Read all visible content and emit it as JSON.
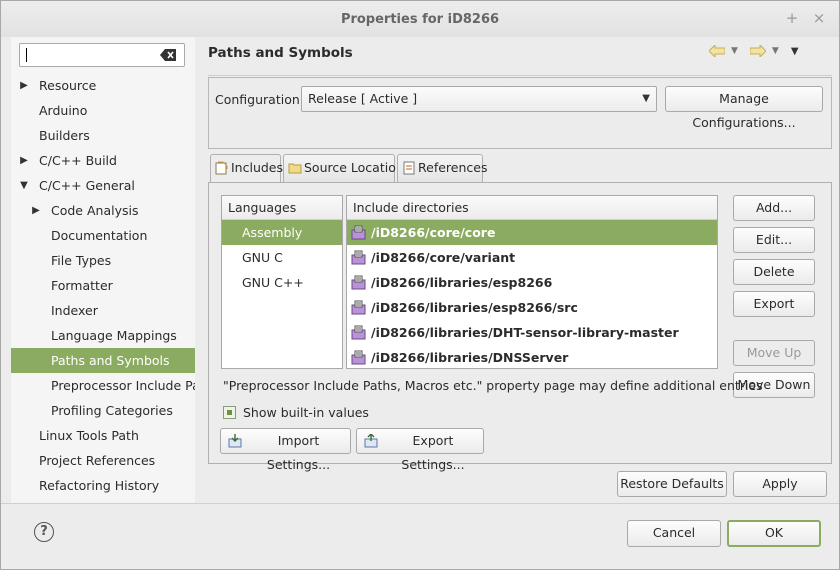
{
  "window": {
    "title": "Properties for iD8266",
    "min_glyph": "+",
    "close_glyph": "×"
  },
  "filter": {
    "value": "",
    "clear_icon": "clear-icon"
  },
  "sidebar": {
    "items": [
      {
        "label": "Resource",
        "expander": "▶"
      },
      {
        "label": "Arduino",
        "expander": ""
      },
      {
        "label": "Builders",
        "expander": ""
      },
      {
        "label": "C/C++ Build",
        "expander": "▶"
      },
      {
        "label": "C/C++ General",
        "expander": "▼"
      },
      {
        "label": "Code Analysis",
        "expander": "▶"
      },
      {
        "label": "Documentation",
        "expander": ""
      },
      {
        "label": "File Types",
        "expander": ""
      },
      {
        "label": "Formatter",
        "expander": ""
      },
      {
        "label": "Indexer",
        "expander": ""
      },
      {
        "label": "Language Mappings",
        "expander": ""
      },
      {
        "label": "Paths and Symbols",
        "expander": ""
      },
      {
        "label": "Preprocessor Include Paths, Macros etc.",
        "expander": ""
      },
      {
        "label": "Profiling Categories",
        "expander": ""
      },
      {
        "label": "Linux Tools Path",
        "expander": ""
      },
      {
        "label": "Project References",
        "expander": ""
      },
      {
        "label": "Refactoring History",
        "expander": ""
      }
    ],
    "selected": "Paths and Symbols"
  },
  "page": {
    "title": "Paths and Symbols",
    "nav": {
      "back_icon": "back-arrow-icon",
      "forward_icon": "forward-arrow-icon",
      "dropdown_glyph": "▼"
    }
  },
  "configuration": {
    "label": "Configuration:",
    "value": "Release  [ Active ]",
    "dropdown_glyph": "▼",
    "manage_button": "Manage Configurations..."
  },
  "tabs": [
    {
      "label": "Includes",
      "active": true
    },
    {
      "label": "Source Location",
      "active": false
    },
    {
      "label": "References",
      "active": false
    }
  ],
  "languages": {
    "header": "Languages",
    "items": [
      "Assembly",
      "GNU C",
      "GNU C++"
    ],
    "selected": "Assembly"
  },
  "includes": {
    "header": "Include directories",
    "items": [
      "/iD8266/core/core",
      "/iD8266/core/variant",
      "/iD8266/libraries/esp8266",
      "/iD8266/libraries/esp8266/src",
      "/iD8266/libraries/DHT-sensor-library-master",
      "/iD8266/libraries/DNSServer"
    ],
    "selected": "/iD8266/core/core"
  },
  "side_buttons": {
    "add": "Add...",
    "edit": "Edit...",
    "delete": "Delete",
    "export": "Export",
    "move_up": "Move Up",
    "move_down": "Move Down"
  },
  "note": "\"Preprocessor Include Paths, Macros etc.\" property page may define additional entries",
  "show_builtin": {
    "label": "Show built-in values",
    "checked": true
  },
  "import_settings": "Import Settings...",
  "export_settings": "Export Settings...",
  "restore_defaults": "Restore Defaults",
  "apply": "Apply",
  "help_glyph": "?",
  "cancel": "Cancel",
  "ok": "OK",
  "colors": {
    "selection": "#8aab60",
    "default_border": "#8aab60"
  }
}
